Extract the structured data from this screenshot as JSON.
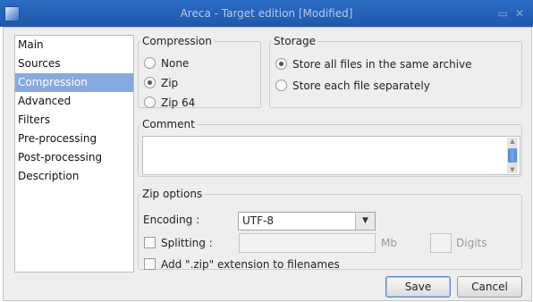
{
  "window": {
    "title": "Areca - Target edition [Modified]",
    "minimize_glyph": "▭",
    "close_glyph": "✕"
  },
  "nav": {
    "items": [
      {
        "label": "Main"
      },
      {
        "label": "Sources"
      },
      {
        "label": "Compression",
        "selected": true
      },
      {
        "label": "Advanced"
      },
      {
        "label": "Filters"
      },
      {
        "label": "Pre-processing"
      },
      {
        "label": "Post-processing"
      },
      {
        "label": "Description"
      }
    ]
  },
  "compression": {
    "legend": "Compression",
    "options": [
      {
        "label": "None",
        "selected": false
      },
      {
        "label": "Zip",
        "selected": true
      },
      {
        "label": "Zip 64",
        "selected": false
      }
    ]
  },
  "storage": {
    "legend": "Storage",
    "options": [
      {
        "label": "Store all files in the same archive",
        "selected": true
      },
      {
        "label": "Store each file separately",
        "selected": false
      }
    ]
  },
  "comment": {
    "legend": "Comment",
    "value": ""
  },
  "zip_options": {
    "legend": "Zip options",
    "encoding_label": "Encoding :",
    "encoding_value": "UTF-8",
    "splitting_label": "Splitting :",
    "splitting_checked": false,
    "splitting_value": "",
    "mb_label": "Mb",
    "digits_value": "",
    "digits_label": "Digits",
    "add_extension_label": "Add \".zip\" extension to filenames",
    "add_extension_checked": false
  },
  "buttons": {
    "save": "Save",
    "cancel": "Cancel"
  },
  "colors": {
    "titlebar": "#1f58aa",
    "selection": "#86a9e0",
    "scroll_thumb": "#5f94d8"
  },
  "icons": {
    "app": "areca-app-icon",
    "combo_arrow": "▼"
  }
}
